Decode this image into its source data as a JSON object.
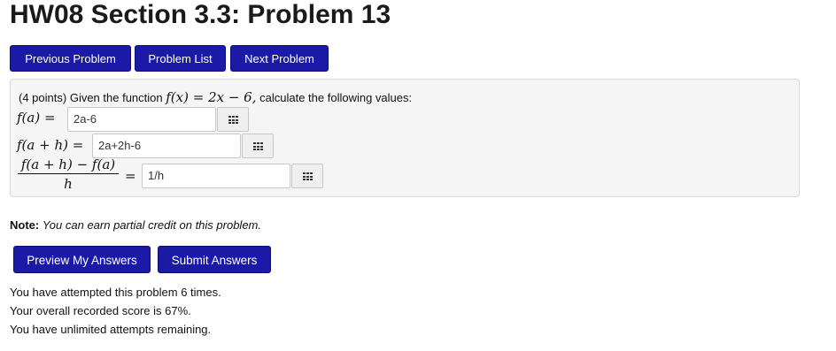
{
  "page": {
    "title": "HW08 Section 3.3: Problem 13"
  },
  "nav": {
    "previous_label": "Previous Problem",
    "list_label": "Problem List",
    "next_label": "Next Problem"
  },
  "problem": {
    "points": "(4 points)",
    "text_before": "Given the function",
    "function": "f(x) = 2x − 6,",
    "text_after": "calculate the following values:",
    "rows": [
      {
        "label": "f(a) =",
        "answer": "2a-6"
      },
      {
        "label": "f(a + h) =",
        "answer": "2a+2h-6"
      },
      {
        "label_num": "f(a + h) − f(a)",
        "label_den": "h",
        "eq": "=",
        "answer": "1/h"
      }
    ]
  },
  "note": {
    "label": "Note:",
    "text": "You can earn partial credit on this problem."
  },
  "actions": {
    "preview_label": "Preview My Answers",
    "submit_label": "Submit Answers"
  },
  "status": {
    "attempts": "You have attempted this problem 6 times.",
    "score": "Your overall recorded score is 67%.",
    "remaining": "You have unlimited attempts remaining."
  },
  "icons": {
    "keyboard": "equation-editor-grid-icon"
  },
  "colors": {
    "button": "#1a1aa6",
    "panel": "#f5f5f5"
  }
}
